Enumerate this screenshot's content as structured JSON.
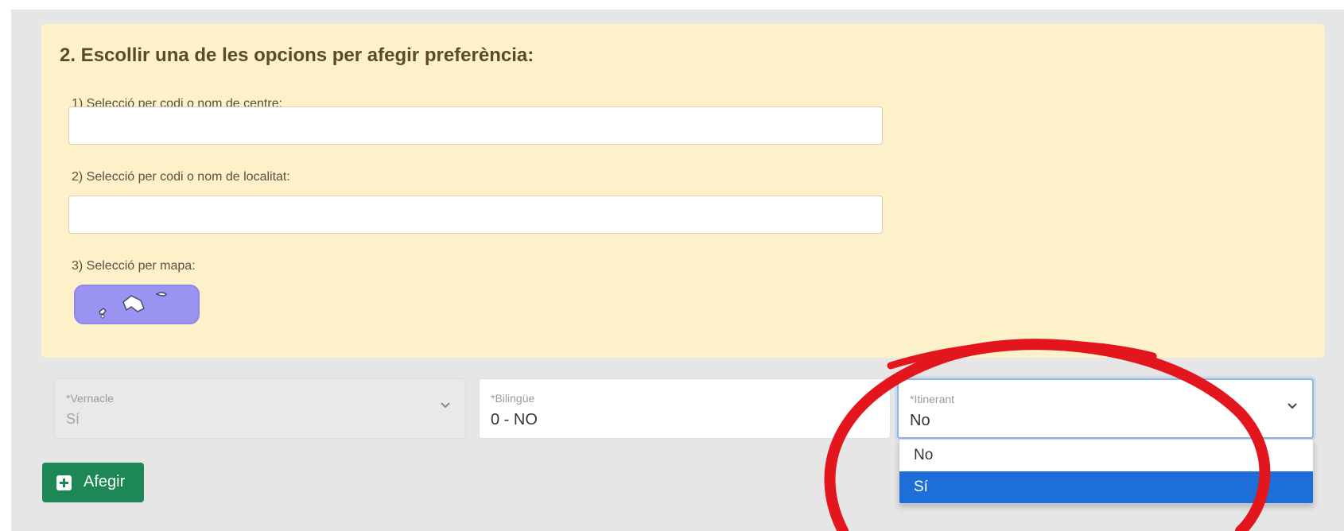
{
  "preference": {
    "title": "2. Escollir una de les opcions per afegir preferència:",
    "option1_label": "1) Selecció per codi o nom de centre:",
    "option2_label": "2) Selecció per codi o nom de localitat:",
    "option3_label": "3) Selecció per mapa:",
    "center_input_value": "",
    "locality_input_value": ""
  },
  "fields": {
    "vernacle": {
      "label": "*Vernacle",
      "value": "Sí",
      "disabled": true
    },
    "bilingue": {
      "label": "*Bilingüe",
      "value": "0 - NO"
    },
    "itinerant": {
      "label": "*Itinerant",
      "value": "No",
      "open": true
    }
  },
  "itinerant_options": [
    {
      "label": "No"
    },
    {
      "label": "Sí",
      "highlighted": true
    }
  ],
  "actions": {
    "add_label": "Afegir"
  },
  "colors": {
    "panel_bg": "#fdf1ca",
    "add_button": "#1d8755",
    "selected_option": "#1d6ed8",
    "map_button": "#9b93f2",
    "annotation_ring": "#e3161e"
  },
  "icons": {
    "map": "balearic-islands-map-icon",
    "add": "plus-square-icon",
    "select": "chevron-down-icon"
  }
}
